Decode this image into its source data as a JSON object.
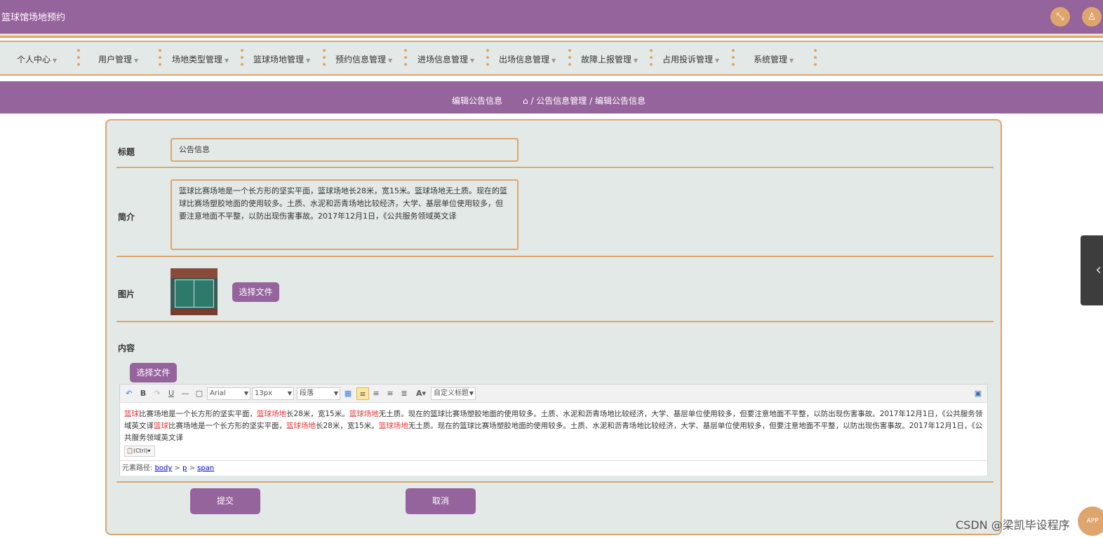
{
  "app": {
    "title": "篮球馆场地预约"
  },
  "header_icons": {
    "fullscreen": "⤡",
    "user": "♙"
  },
  "nav": {
    "items": [
      "个人中心",
      "用户管理",
      "场地类型管理",
      "篮球场地管理",
      "预约信息管理",
      "进场信息管理",
      "出场信息管理",
      "故障上报管理",
      "占用投诉管理",
      "系统管理"
    ]
  },
  "breadcrumb": {
    "page_title": "编辑公告信息",
    "path": "/ 公告信息管理 / 编辑公告信息"
  },
  "form": {
    "title_label": "标题",
    "title_value": "公告信息",
    "summary_label": "简介",
    "summary_value": "篮球比赛场地是一个长方形的坚实平面，篮球场地长28米，宽15米。篮球场地无土质。现在的篮球比赛场塑胶地面的使用较多。土质、水泥和沥青场地比较经济，大学、基层单位使用较多，但要注意地面不平整，以防出现伤害事故。2017年12月1日，《公共服务领域英文译",
    "image_label": "图片",
    "choose_file_label": "选择文件",
    "content_label": "内容",
    "content_choose_file_label": "选择文件",
    "submit_label": "提交",
    "cancel_label": "取消"
  },
  "editor": {
    "font_family": "Arial",
    "font_size": "13px",
    "paragraph": "段落",
    "custom_title": "自定义标题",
    "content_segments": [
      {
        "text": "篮球",
        "red": true
      },
      {
        "text": "比赛场地是一个长方形的坚实平面，",
        "red": false
      },
      {
        "text": "篮球场地",
        "red": true
      },
      {
        "text": "长28米，宽15米。",
        "red": false
      },
      {
        "text": "篮球场地",
        "red": true
      },
      {
        "text": "无土质。现在的篮球比赛场塑胶地面的使用较多。土质、水泥和沥青场地比较经济，大学、基层单位使用较多，但要注意地面不平整，以防出现伤害事故。2017年12月1日，《公共服务领域英文译",
        "red": false
      },
      {
        "text": "篮球",
        "red": true
      },
      {
        "text": "比赛场地是一个长方形的坚实平面，",
        "red": false
      },
      {
        "text": "篮球场地",
        "red": true
      },
      {
        "text": "长28米，宽15米。",
        "red": false
      },
      {
        "text": "篮球场地",
        "red": true
      },
      {
        "text": "无土质。现在的篮球比赛场塑胶地面的使用较多。土质、水泥和沥青场地比较经济，大学、基层单位使用较多，但要注意地面不平整，以防出现伤害事故。2017年12月1日，《公共服务领域英文译",
        "red": false
      }
    ],
    "paste_label": "(Ctrl)",
    "path_label": "元素路径:",
    "path_body": "body",
    "path_p": "p",
    "path_span": "span"
  },
  "watermark": "CSDN @梁凯毕设程序",
  "app_badge": "APP",
  "colors": {
    "primary": "#96649c",
    "accent": "#dea56e",
    "panel_bg": "#e2e9e6"
  }
}
